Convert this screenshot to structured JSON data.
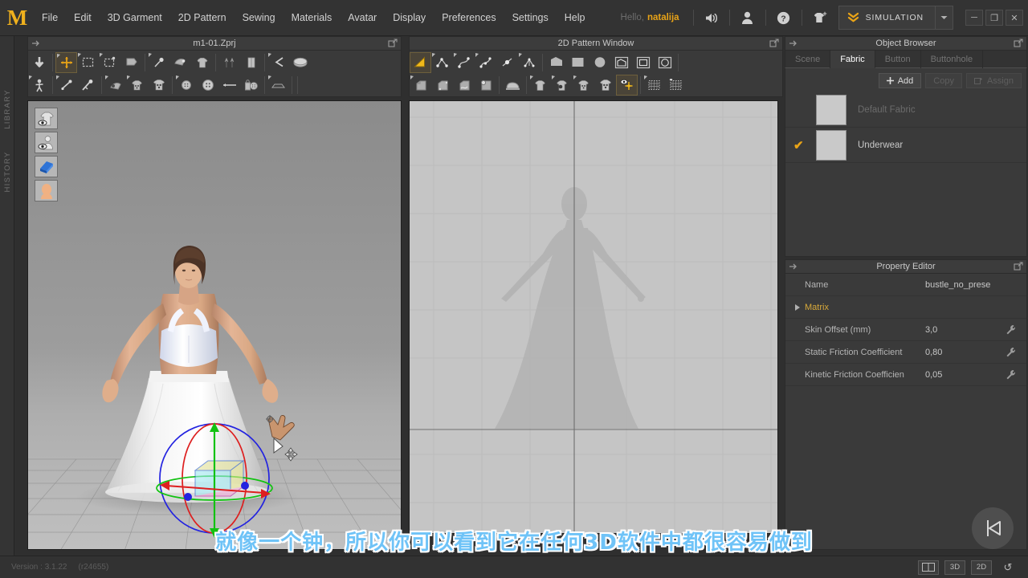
{
  "app": {
    "logo_letter": "M",
    "greeting": "Hello,",
    "username": "natalija",
    "simulation_label": "SIMULATION",
    "version": "Version : 3.1.22",
    "build": "(r24655)"
  },
  "menu": {
    "items": [
      {
        "label": "File"
      },
      {
        "label": "Edit"
      },
      {
        "label": "3D Garment"
      },
      {
        "label": "2D Pattern"
      },
      {
        "label": "Sewing"
      },
      {
        "label": "Materials"
      },
      {
        "label": "Avatar"
      },
      {
        "label": "Display"
      },
      {
        "label": "Preferences"
      },
      {
        "label": "Settings"
      },
      {
        "label": "Help"
      }
    ],
    "icons": [
      {
        "name": "sound-icon"
      },
      {
        "name": "user-icon"
      },
      {
        "name": "help-icon"
      },
      {
        "name": "add-garment-icon"
      }
    ],
    "window_buttons": [
      {
        "name": "minimize-button",
        "glyph": "─"
      },
      {
        "name": "restore-button",
        "glyph": "❐"
      },
      {
        "name": "close-button",
        "glyph": "✕"
      }
    ]
  },
  "left_rail": {
    "tabs": [
      {
        "label": "LIBRARY"
      },
      {
        "label": "HISTORY"
      }
    ]
  },
  "view3d": {
    "title": "m1-01.Zprj",
    "viewport_buttons": [
      {
        "name": "show-garment-toggle"
      },
      {
        "name": "show-avatar-toggle"
      },
      {
        "name": "show-fabric-toggle"
      },
      {
        "name": "show-skin-toggle"
      }
    ],
    "toolbar_row1": [
      {
        "name": "simulate-tool"
      },
      {
        "name": "transform-garment-tool",
        "active": true
      },
      {
        "name": "select-mesh-box-tool"
      },
      {
        "name": "select-mesh-tool"
      },
      {
        "name": "unfold-arrange-tool"
      },
      {
        "name": "pin-tool"
      },
      {
        "name": "fold-arrangement-tool"
      },
      {
        "name": "gravity-tool"
      },
      {
        "name": "zipper-tool"
      },
      {
        "name": "attach-tool"
      },
      {
        "name": "segment-sewing-tool"
      },
      {
        "name": "free-sewing-tool"
      }
    ],
    "toolbar_row2": [
      {
        "name": "avatar-transform-tool"
      },
      {
        "name": "x-ray-joints-tool"
      },
      {
        "name": "pose-edit-tool"
      },
      {
        "name": "texture-tool"
      },
      {
        "name": "print-layout-tool"
      },
      {
        "name": "print-pattern-tool"
      },
      {
        "name": "button-tool"
      },
      {
        "name": "buttonhole-tool"
      },
      {
        "name": "measure-tape-tool"
      },
      {
        "name": "lock-fit-tool"
      },
      {
        "name": "flatten-tool"
      }
    ]
  },
  "view2d": {
    "title": "2D Pattern Window",
    "toolbar_row1": [
      {
        "name": "editor-pattern-tool",
        "active": true
      },
      {
        "name": "edit-point-tool"
      },
      {
        "name": "edit-curve-tool"
      },
      {
        "name": "edit-curve-point-tool"
      },
      {
        "name": "add-point-split-tool"
      },
      {
        "name": "add-segment-tool"
      },
      {
        "name": "polygon-tool"
      },
      {
        "name": "rectangle-tool"
      },
      {
        "name": "circle-tool"
      },
      {
        "name": "internal-polygon-tool"
      },
      {
        "name": "internal-rectangle-tool"
      },
      {
        "name": "internal-circle-tool"
      }
    ],
    "toolbar_row2": [
      {
        "name": "fold-arrangement-2d-tool"
      },
      {
        "name": "pleat-tool"
      },
      {
        "name": "curve-pleat-tool"
      },
      {
        "name": "trace-tool"
      },
      {
        "name": "steam-press-tool"
      },
      {
        "name": "garment-select-tool"
      },
      {
        "name": "texture-2d-tool"
      },
      {
        "name": "button-2d-tool"
      },
      {
        "name": "buttonhole-2d-tool"
      },
      {
        "name": "particle-distance-tool",
        "active": true
      },
      {
        "name": "mesh-select-tool"
      },
      {
        "name": "mesh-box-select-tool"
      }
    ]
  },
  "object_browser": {
    "title": "Object Browser",
    "tabs": [
      {
        "label": "Scene",
        "active": false
      },
      {
        "label": "Fabric",
        "active": true
      },
      {
        "label": "Button",
        "active": false
      },
      {
        "label": "Buttonhole",
        "active": false
      }
    ],
    "actions": [
      {
        "label": "Add",
        "icon": "plus-icon",
        "enabled": true
      },
      {
        "label": "Copy",
        "icon": "copy-icon",
        "enabled": false
      },
      {
        "label": "Assign",
        "icon": "assign-icon",
        "enabled": false
      }
    ],
    "rows": [
      {
        "checked": false,
        "name": "Default Fabric",
        "swatch": "#c9c9c9",
        "dim": true
      },
      {
        "checked": true,
        "name": "Underwear",
        "swatch": "#c9c9c9",
        "dim": false
      }
    ]
  },
  "property_editor": {
    "title": "Property Editor",
    "rows": [
      {
        "key": "Name",
        "value": "bustle_no_prese",
        "wrench": false,
        "group": false
      },
      {
        "key": "Matrix",
        "value": "",
        "wrench": false,
        "group": true
      },
      {
        "key": "Skin Offset (mm)",
        "value": "3,0",
        "wrench": true,
        "group": false
      },
      {
        "key": "Static Friction Coefficient",
        "value": "0,80",
        "wrench": true,
        "group": false
      },
      {
        "key": "Kinetic Friction Coefficien",
        "value": "0,05",
        "wrench": true,
        "group": false
      }
    ]
  },
  "status_bar": {
    "buttons": [
      {
        "name": "split-view-button",
        "label": ""
      },
      {
        "name": "view-3d-button",
        "label": "3D"
      },
      {
        "name": "view-2d-button",
        "label": "2D"
      },
      {
        "name": "reset-view-button",
        "label": "↺"
      }
    ]
  },
  "subtitle": {
    "text": "就像一个钟，所以你可以看到它在任何3D软件中都很容易做到",
    "color": "#6fc3f7"
  },
  "colors": {
    "accent": "#e8a317",
    "panel_bg": "#3a3a3a",
    "menu_bg": "#333333",
    "subtitle": "#6fc3f7"
  }
}
